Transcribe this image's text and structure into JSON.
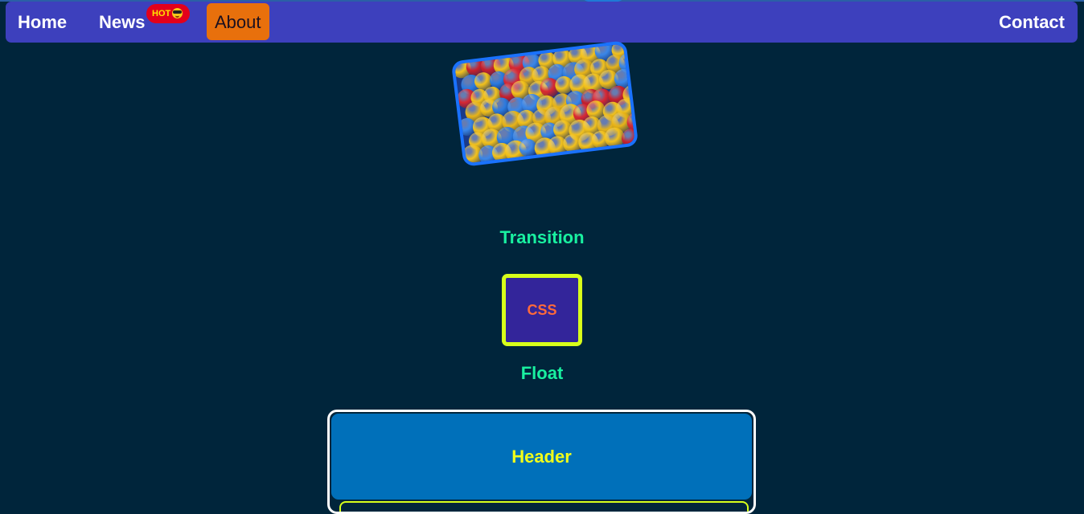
{
  "nav": {
    "home": "Home",
    "news": "News",
    "news_badge": "HOT",
    "about": "About",
    "contact": "Contact"
  },
  "sections": {
    "transition_title": "Transition",
    "transition_box_text": "CSS",
    "float_title": "Float",
    "float_header": "Header"
  },
  "colors": {
    "background": "#00253b",
    "navbar": "#3d40bd",
    "active_tab": "#e8700c",
    "section_title": "#19f0a0",
    "css_box_border": "#d8ff1a",
    "css_box_fill": "#33259a",
    "header_fill": "#0070ba",
    "header_text": "#f2ff1a"
  },
  "image": {
    "subject": "pile of emoji balls",
    "icons": [
      "hot-badge-emoji-icon"
    ]
  }
}
